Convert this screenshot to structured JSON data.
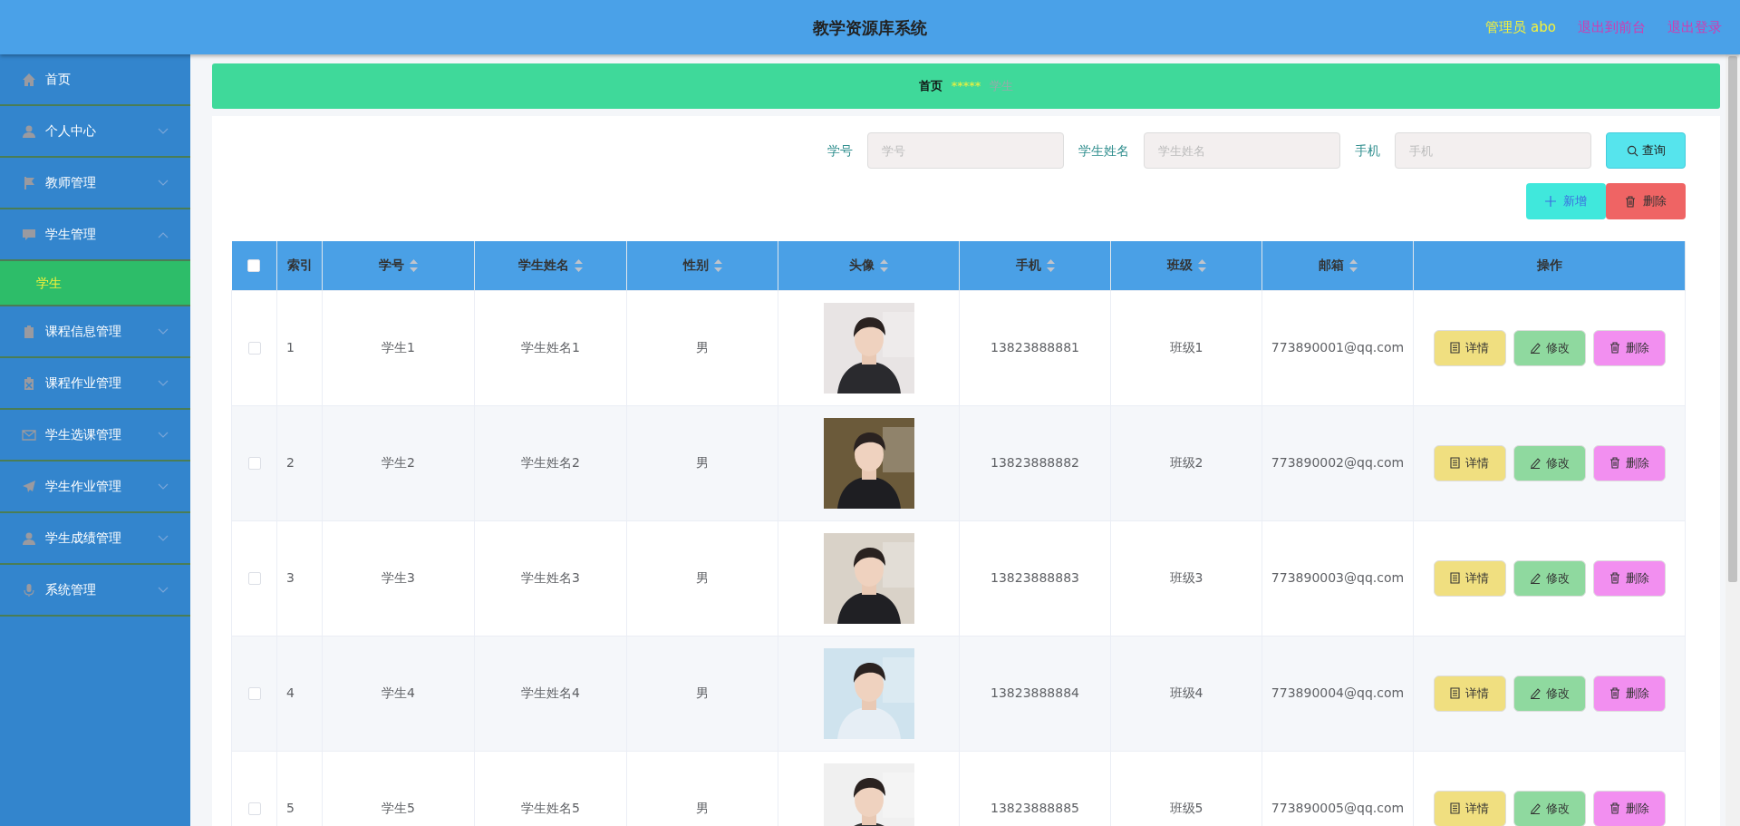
{
  "header": {
    "title": "教学资源库系统",
    "user": "管理员 abo",
    "links": [
      "退出到前台",
      "退出登录"
    ]
  },
  "sidebar": {
    "items": [
      {
        "label": "首页"
      },
      {
        "label": "个人中心",
        "expanded": false
      },
      {
        "label": "教师管理",
        "expanded": false
      },
      {
        "label": "学生管理",
        "expanded": true,
        "children": [
          {
            "label": "学生",
            "selected": true
          }
        ]
      },
      {
        "label": "课程信息管理",
        "expanded": false
      },
      {
        "label": "课程作业管理",
        "expanded": false
      },
      {
        "label": "学生选课管理",
        "expanded": false
      },
      {
        "label": "学生作业管理",
        "expanded": false
      },
      {
        "label": "学生成绩管理",
        "expanded": false
      },
      {
        "label": "系统管理",
        "expanded": false
      }
    ]
  },
  "breadcrumb": {
    "items": [
      "首页",
      "学生"
    ],
    "separator": "*****"
  },
  "search": {
    "fields": [
      {
        "label": "学号",
        "placeholder": "学号"
      },
      {
        "label": "学生姓名",
        "placeholder": "学生姓名"
      },
      {
        "label": "手机",
        "placeholder": "手机"
      }
    ],
    "button": "查询"
  },
  "actions": {
    "add": "新增",
    "delete": "删除"
  },
  "table": {
    "select_all": {
      "checked": false
    },
    "columns": [
      {
        "label": "索引",
        "sortable": false
      },
      {
        "label": "学号",
        "sortable": true
      },
      {
        "label": "学生姓名",
        "sortable": true
      },
      {
        "label": "性别",
        "sortable": true
      },
      {
        "label": "头像",
        "sortable": true
      },
      {
        "label": "手机",
        "sortable": true
      },
      {
        "label": "班级",
        "sortable": true
      },
      {
        "label": "邮箱",
        "sortable": true
      },
      {
        "label": "操作",
        "sortable": false
      }
    ],
    "rows": [
      {
        "checked": false,
        "index": "1",
        "student_id": "学生1",
        "name": "学生姓名1",
        "gender": "男",
        "phone": "13823888881",
        "class": "班级1",
        "email": "773890001@qq.com",
        "buttons": [
          "详情",
          "修改",
          "删除"
        ]
      },
      {
        "checked": false,
        "index": "2",
        "student_id": "学生2",
        "name": "学生姓名2",
        "gender": "男",
        "phone": "13823888882",
        "class": "班级2",
        "email": "773890002@qq.com",
        "buttons": [
          "详情",
          "修改",
          "删除"
        ]
      },
      {
        "checked": false,
        "index": "3",
        "student_id": "学生3",
        "name": "学生姓名3",
        "gender": "男",
        "phone": "13823888883",
        "class": "班级3",
        "email": "773890003@qq.com",
        "buttons": [
          "详情",
          "修改",
          "删除"
        ]
      },
      {
        "checked": false,
        "index": "4",
        "student_id": "学生4",
        "name": "学生姓名4",
        "gender": "男",
        "phone": "13823888884",
        "class": "班级4",
        "email": "773890004@qq.com",
        "buttons": [
          "详情",
          "修改",
          "删除"
        ]
      },
      {
        "checked": false,
        "index": "5",
        "student_id": "学生5",
        "name": "学生姓名5",
        "gender": "男",
        "phone": "13823888885",
        "class": "班级5",
        "email": "773890005@qq.com",
        "buttons": [
          "详情",
          "修改",
          "删除"
        ]
      }
    ]
  }
}
